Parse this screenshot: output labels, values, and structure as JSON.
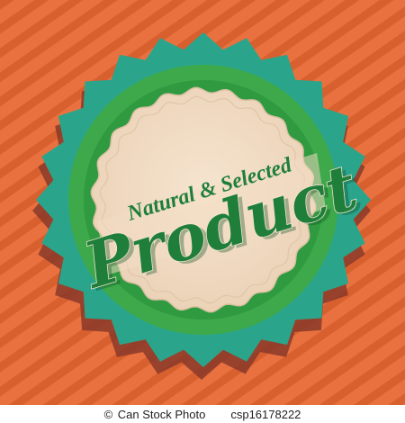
{
  "badge": {
    "line1": "Natural & Selected",
    "line2": "Product"
  },
  "credit": {
    "symbol": "©",
    "source": "Can Stock Photo",
    "image_code": "csp16178222"
  },
  "colors": {
    "background": "#e8713f",
    "stripe": "#d8602f",
    "outer_badge": "#2aa58c",
    "outer_shadow": "#8a3a2a",
    "ring": "#3da94a",
    "inner_disc": "#f3dcc3",
    "text_green": "#1e7e3a"
  }
}
